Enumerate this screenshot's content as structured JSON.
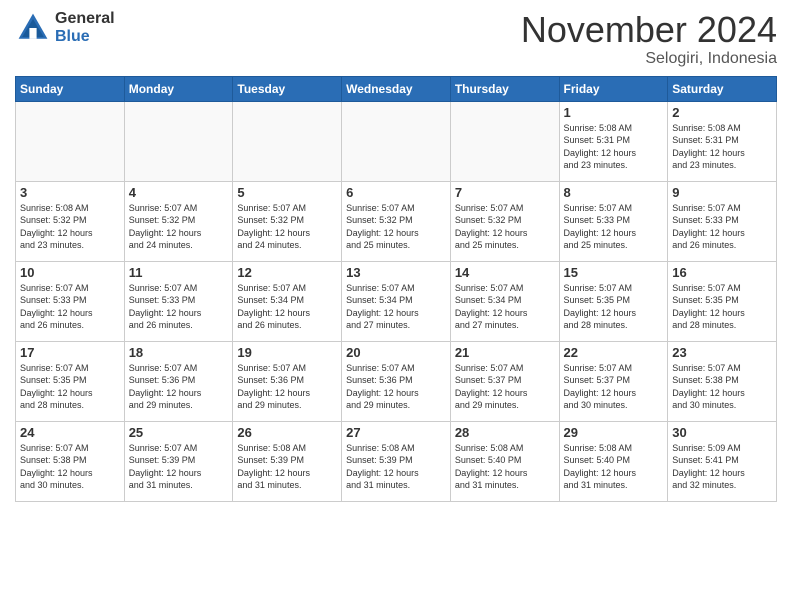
{
  "logo": {
    "general": "General",
    "blue": "Blue"
  },
  "header": {
    "month": "November 2024",
    "location": "Selogiri, Indonesia"
  },
  "weekdays": [
    "Sunday",
    "Monday",
    "Tuesday",
    "Wednesday",
    "Thursday",
    "Friday",
    "Saturday"
  ],
  "weeks": [
    [
      {
        "day": "",
        "info": ""
      },
      {
        "day": "",
        "info": ""
      },
      {
        "day": "",
        "info": ""
      },
      {
        "day": "",
        "info": ""
      },
      {
        "day": "",
        "info": ""
      },
      {
        "day": "1",
        "info": "Sunrise: 5:08 AM\nSunset: 5:31 PM\nDaylight: 12 hours\nand 23 minutes."
      },
      {
        "day": "2",
        "info": "Sunrise: 5:08 AM\nSunset: 5:31 PM\nDaylight: 12 hours\nand 23 minutes."
      }
    ],
    [
      {
        "day": "3",
        "info": "Sunrise: 5:08 AM\nSunset: 5:32 PM\nDaylight: 12 hours\nand 23 minutes."
      },
      {
        "day": "4",
        "info": "Sunrise: 5:07 AM\nSunset: 5:32 PM\nDaylight: 12 hours\nand 24 minutes."
      },
      {
        "day": "5",
        "info": "Sunrise: 5:07 AM\nSunset: 5:32 PM\nDaylight: 12 hours\nand 24 minutes."
      },
      {
        "day": "6",
        "info": "Sunrise: 5:07 AM\nSunset: 5:32 PM\nDaylight: 12 hours\nand 25 minutes."
      },
      {
        "day": "7",
        "info": "Sunrise: 5:07 AM\nSunset: 5:32 PM\nDaylight: 12 hours\nand 25 minutes."
      },
      {
        "day": "8",
        "info": "Sunrise: 5:07 AM\nSunset: 5:33 PM\nDaylight: 12 hours\nand 25 minutes."
      },
      {
        "day": "9",
        "info": "Sunrise: 5:07 AM\nSunset: 5:33 PM\nDaylight: 12 hours\nand 26 minutes."
      }
    ],
    [
      {
        "day": "10",
        "info": "Sunrise: 5:07 AM\nSunset: 5:33 PM\nDaylight: 12 hours\nand 26 minutes."
      },
      {
        "day": "11",
        "info": "Sunrise: 5:07 AM\nSunset: 5:33 PM\nDaylight: 12 hours\nand 26 minutes."
      },
      {
        "day": "12",
        "info": "Sunrise: 5:07 AM\nSunset: 5:34 PM\nDaylight: 12 hours\nand 26 minutes."
      },
      {
        "day": "13",
        "info": "Sunrise: 5:07 AM\nSunset: 5:34 PM\nDaylight: 12 hours\nand 27 minutes."
      },
      {
        "day": "14",
        "info": "Sunrise: 5:07 AM\nSunset: 5:34 PM\nDaylight: 12 hours\nand 27 minutes."
      },
      {
        "day": "15",
        "info": "Sunrise: 5:07 AM\nSunset: 5:35 PM\nDaylight: 12 hours\nand 28 minutes."
      },
      {
        "day": "16",
        "info": "Sunrise: 5:07 AM\nSunset: 5:35 PM\nDaylight: 12 hours\nand 28 minutes."
      }
    ],
    [
      {
        "day": "17",
        "info": "Sunrise: 5:07 AM\nSunset: 5:35 PM\nDaylight: 12 hours\nand 28 minutes."
      },
      {
        "day": "18",
        "info": "Sunrise: 5:07 AM\nSunset: 5:36 PM\nDaylight: 12 hours\nand 29 minutes."
      },
      {
        "day": "19",
        "info": "Sunrise: 5:07 AM\nSunset: 5:36 PM\nDaylight: 12 hours\nand 29 minutes."
      },
      {
        "day": "20",
        "info": "Sunrise: 5:07 AM\nSunset: 5:36 PM\nDaylight: 12 hours\nand 29 minutes."
      },
      {
        "day": "21",
        "info": "Sunrise: 5:07 AM\nSunset: 5:37 PM\nDaylight: 12 hours\nand 29 minutes."
      },
      {
        "day": "22",
        "info": "Sunrise: 5:07 AM\nSunset: 5:37 PM\nDaylight: 12 hours\nand 30 minutes."
      },
      {
        "day": "23",
        "info": "Sunrise: 5:07 AM\nSunset: 5:38 PM\nDaylight: 12 hours\nand 30 minutes."
      }
    ],
    [
      {
        "day": "24",
        "info": "Sunrise: 5:07 AM\nSunset: 5:38 PM\nDaylight: 12 hours\nand 30 minutes."
      },
      {
        "day": "25",
        "info": "Sunrise: 5:07 AM\nSunset: 5:39 PM\nDaylight: 12 hours\nand 31 minutes."
      },
      {
        "day": "26",
        "info": "Sunrise: 5:08 AM\nSunset: 5:39 PM\nDaylight: 12 hours\nand 31 minutes."
      },
      {
        "day": "27",
        "info": "Sunrise: 5:08 AM\nSunset: 5:39 PM\nDaylight: 12 hours\nand 31 minutes."
      },
      {
        "day": "28",
        "info": "Sunrise: 5:08 AM\nSunset: 5:40 PM\nDaylight: 12 hours\nand 31 minutes."
      },
      {
        "day": "29",
        "info": "Sunrise: 5:08 AM\nSunset: 5:40 PM\nDaylight: 12 hours\nand 31 minutes."
      },
      {
        "day": "30",
        "info": "Sunrise: 5:09 AM\nSunset: 5:41 PM\nDaylight: 12 hours\nand 32 minutes."
      }
    ]
  ]
}
